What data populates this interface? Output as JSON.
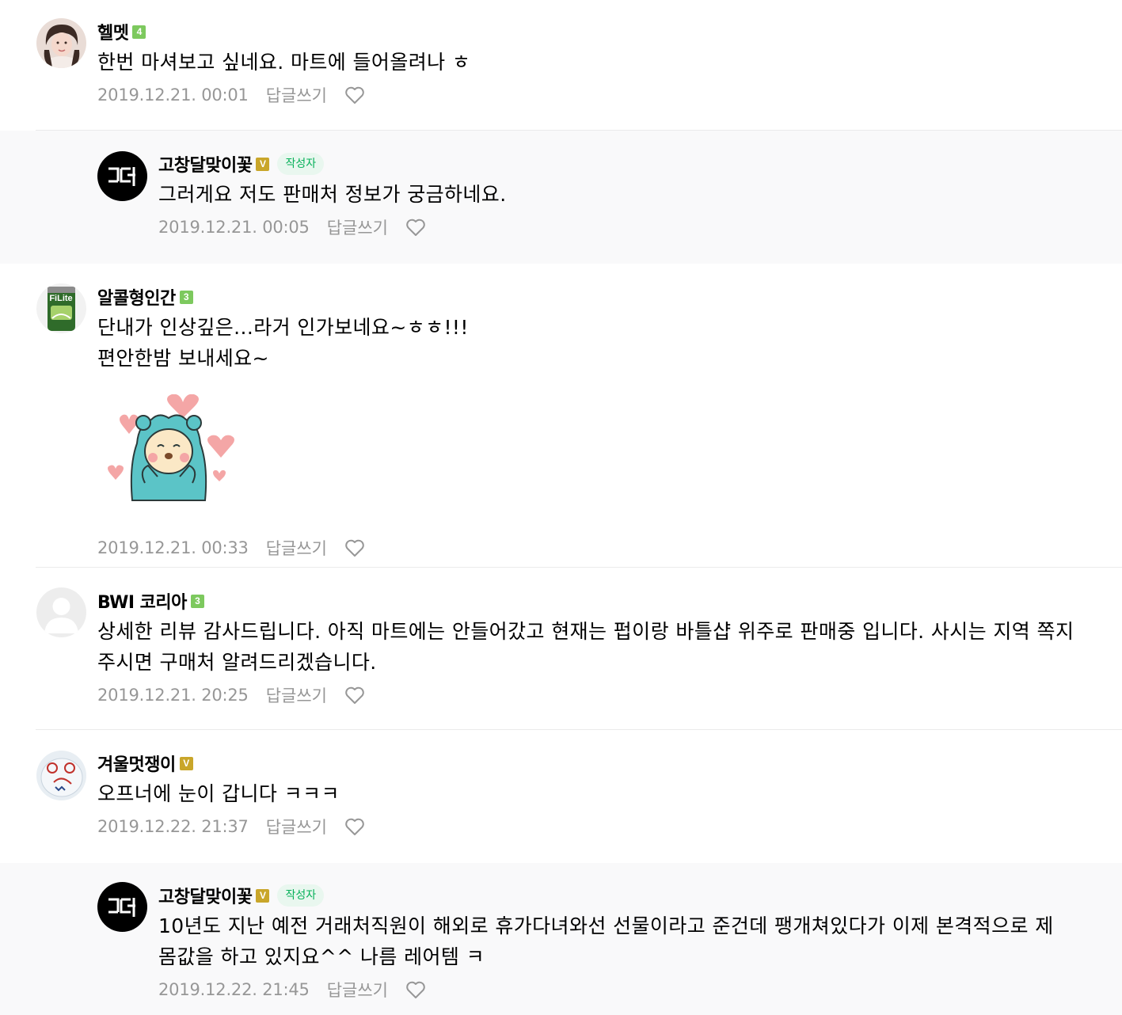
{
  "reply_label": "답글쓰기",
  "author_badge_label": "작성자",
  "comments": [
    {
      "nickname": "헬멧",
      "level": "4",
      "text": [
        "한번 마셔보고 싶네요. 마트에 들어올려나 ㅎ"
      ],
      "date": "2019.12.21. 00:01",
      "avatar_icon": "profile-photo-woman",
      "is_reply": false,
      "is_author": false
    },
    {
      "nickname": "고창달맞이꽃",
      "level": "V",
      "text": [
        "그러게요 저도 판매처 정보가 궁금하네요."
      ],
      "date": "2019.12.21. 00:05",
      "avatar_icon": "gdm-logo",
      "is_reply": true,
      "is_author": true
    },
    {
      "nickname": "알콜형인간",
      "level": "3",
      "text": [
        "단내가 인상깊은...라거 인가보네요~ㅎㅎ!!!",
        "편안한밤 보내세요~"
      ],
      "date": "2019.12.21. 00:33",
      "avatar_icon": "beer-can-photo",
      "sticker": "bear-hearts-sticker",
      "is_reply": false,
      "is_author": false
    },
    {
      "nickname": "BWI 코리아",
      "level": "3",
      "text": [
        "상세한 리뷰 감사드립니다. 아직 마트에는 안들어갔고 현재는 펍이랑 바틀샵 위주로 판매중 입니다. 사시는 지역 쪽지 주시면 구매처 알려드리겠습니다."
      ],
      "date": "2019.12.21. 20:25",
      "avatar_icon": "default-user",
      "is_reply": false,
      "is_author": false
    },
    {
      "nickname": "겨울멋쟁이",
      "level": "V",
      "text": [
        "오프너에 눈이 갑니다 ㅋㅋㅋ"
      ],
      "date": "2019.12.22. 21:37",
      "avatar_icon": "doodle-face",
      "is_reply": false,
      "is_author": false
    },
    {
      "nickname": "고창달맞이꽃",
      "level": "V",
      "text": [
        "10년도 지난 예전 거래처직원이 해외로 휴가다녀와선 선물이라고 준건데 팽개쳐있다가 이제 본격적으로 제 몸값을 하고 있지요^^ 나름 레어템 ㅋ"
      ],
      "date": "2019.12.22. 21:45",
      "avatar_icon": "gdm-logo",
      "is_reply": true,
      "is_author": true
    }
  ],
  "colors": {
    "meta_text": "#979797",
    "reply_bg": "#f9f9fa",
    "separator": "#ebebeb",
    "author_badge_text": "#07b15a",
    "author_badge_bg": "#e9f7ef",
    "level_green": "#7dc95e",
    "level_gold": "#c9a62a"
  }
}
